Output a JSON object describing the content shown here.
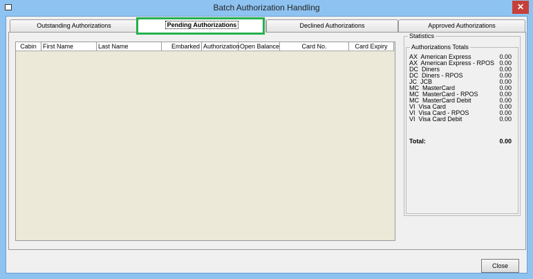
{
  "window": {
    "title": "Batch Authorization Handling",
    "close_glyph": "✕"
  },
  "tabs": [
    {
      "label": "Outstanding Authorizations"
    },
    {
      "label": "Pending Authorizations"
    },
    {
      "label": "Declined Authorizations"
    },
    {
      "label": "Approved Authorizations"
    }
  ],
  "grid": {
    "columns": [
      "Cabin",
      "First Name",
      "Last Name",
      "Embarked",
      "Authorization",
      "Open Balance",
      "Card No.",
      "Card Expiry"
    ],
    "rows": []
  },
  "statistics": {
    "title": "Statistics",
    "group_title": "Authorizations Totals",
    "items": [
      {
        "label": "AX  American Express",
        "value": "0.00"
      },
      {
        "label": "AX  American Express - RPOS",
        "value": "0.00"
      },
      {
        "label": "DC  Diners",
        "value": "0.00"
      },
      {
        "label": "DC  Diners - RPOS",
        "value": "0.00"
      },
      {
        "label": "JC  JCB",
        "value": "0.00"
      },
      {
        "label": "MC  MasterCard",
        "value": "0.00"
      },
      {
        "label": "MC  MasterCard - RPOS",
        "value": "0.00"
      },
      {
        "label": "MC  MasterCard Debit",
        "value": "0.00"
      },
      {
        "label": "VI  Visa Card",
        "value": "0.00"
      },
      {
        "label": "VI  Visa Card - RPOS",
        "value": "0.00"
      },
      {
        "label": "VI  Visa Card Debit",
        "value": "0.00"
      }
    ],
    "total_label": "Total:",
    "total_value": "0.00"
  },
  "buttons": {
    "close": "Close"
  },
  "colors": {
    "highlight": "#23b04a",
    "grid_bg": "#ece9d8"
  }
}
